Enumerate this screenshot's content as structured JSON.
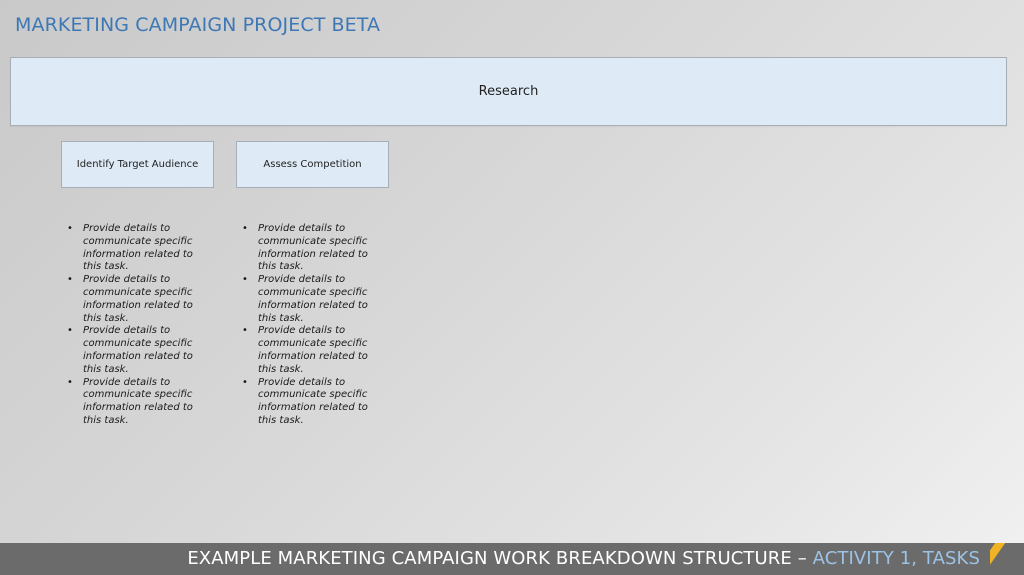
{
  "header": {
    "title": "MARKETING CAMPAIGN PROJECT BETA"
  },
  "research": {
    "label": "Research"
  },
  "tasks": [
    {
      "label": "Identify Target Audience",
      "details": [
        "Provide details to communicate specific information related to this task.",
        "Provide details to communicate specific information related to this task.",
        "Provide details to communicate specific information related to this task.",
        "Provide details to communicate specific information related to this task."
      ]
    },
    {
      "label": "Assess Competition",
      "details": [
        "Provide details to communicate specific information related to this task.",
        "Provide details to communicate specific information related to this task.",
        "Provide details to communicate specific information related to this task.",
        "Provide details to communicate specific information related to this task."
      ]
    }
  ],
  "bullet_glyph": "•",
  "footer": {
    "main_text": "EXAMPLE MARKETING CAMPAIGN WORK BREAKDOWN STRUCTURE – ",
    "accent_text": "ACTIVITY 1, TASKS"
  },
  "colors": {
    "title_blue": "#3d78b5",
    "box_fill": "#deeaf6",
    "footer_bar": "#6b6b6b",
    "footer_accent": "#9cc3e5",
    "stripe_gold": "#f0b323"
  }
}
